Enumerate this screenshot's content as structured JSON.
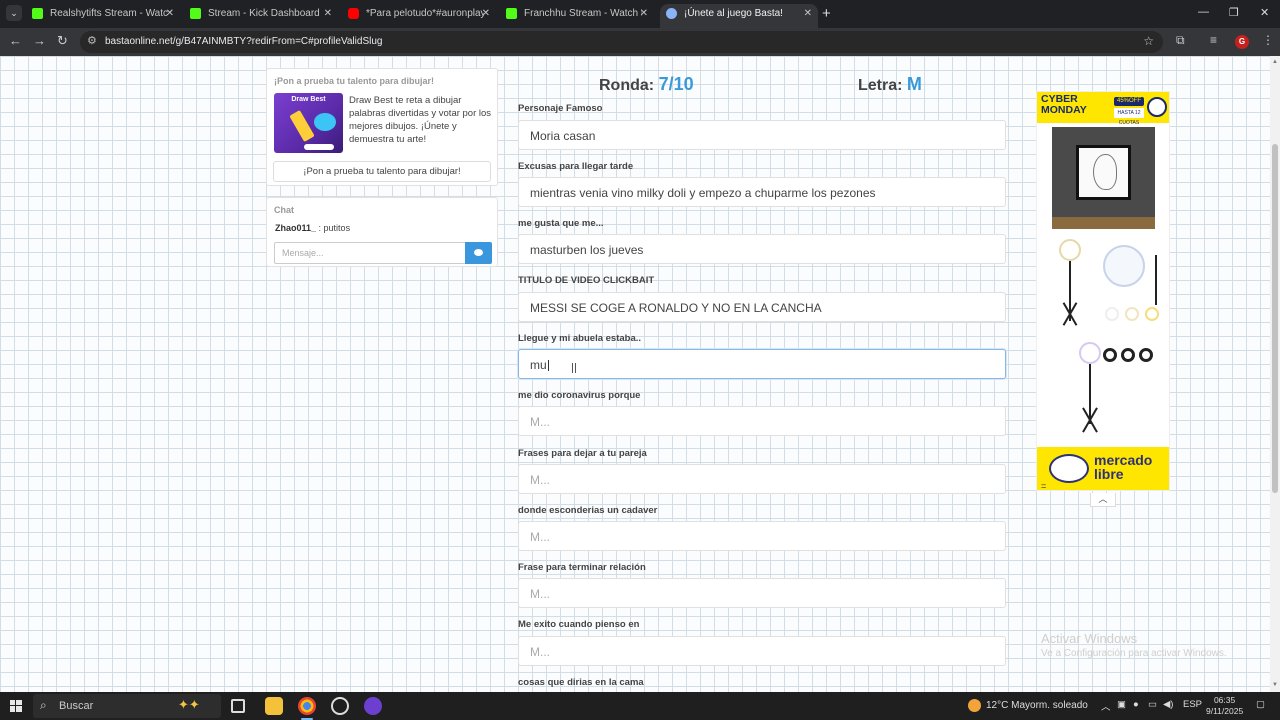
{
  "browser": {
    "tabs": [
      {
        "title": "Realshytifts Stream - Watch Li...",
        "favicon": "kick-icon",
        "close": "✕"
      },
      {
        "title": "Stream - Kick Dashboard",
        "favicon": "kick-icon",
        "close": "✕"
      },
      {
        "title": "*Para pelotudo*#auronplay #tw",
        "favicon": "youtube-icon",
        "close": "✕"
      },
      {
        "title": "Franchhu Stream - Watch Live o",
        "favicon": "kick-icon",
        "close": "✕"
      },
      {
        "title": "¡Únete al juego Basta!",
        "favicon": "globe-icon",
        "close": "✕",
        "active": true
      }
    ],
    "new_tab": "+",
    "url": "bastaonline.net/g/B47AINMBTY?redirFrom=C#profileValidSlug",
    "profile_initial": "G"
  },
  "promo": {
    "heading": "¡Pon a prueba tu talento para dibujar!",
    "thumb_title": "Draw Best",
    "description": "Draw Best te reta a dibujar palabras divertidas y votar por los mejores dibujos. ¡Únete y demuestra tu arte!",
    "cta": "¡Pon a prueba tu talento para dibujar!"
  },
  "chat": {
    "heading": "Chat",
    "messages": [
      {
        "user": "Zhao011_",
        "text": ": putitos"
      }
    ],
    "input_placeholder": "Mensaje..."
  },
  "game": {
    "round_label": "Ronda:",
    "round_value": "7/10",
    "letter_label": "Letra:",
    "letter_value": "M",
    "categories": [
      {
        "label": "Personaje Famoso",
        "value": "Moria casan",
        "placeholder": ""
      },
      {
        "label": "Excusas para llegar tarde",
        "value": "mientras venia vino milky doli y empezo a chuparme los pezones",
        "placeholder": ""
      },
      {
        "label": "me gusta que me...",
        "value": "masturben los jueves",
        "placeholder": ""
      },
      {
        "label": "TITULO DE VIDEO CLICKBAIT",
        "value": "MESSI SE COGE A RONALDO Y NO EN LA CANCHA",
        "placeholder": ""
      },
      {
        "label": "Llegue y mi abuela estaba..",
        "value": "mu",
        "placeholder": "",
        "focused": true
      },
      {
        "label": "me dio coronavirus porque",
        "value": "",
        "placeholder": "M..."
      },
      {
        "label": "Frases para dejar a tu pareja",
        "value": "",
        "placeholder": "M..."
      },
      {
        "label": "donde esconderias un cadaver",
        "value": "",
        "placeholder": "M..."
      },
      {
        "label": "Frase para terminar relación",
        "value": "",
        "placeholder": "M..."
      },
      {
        "label": "Me exito cuando pienso en",
        "value": "",
        "placeholder": "M..."
      },
      {
        "label": "cosas que dirias en la cama",
        "value": "",
        "placeholder": ""
      }
    ]
  },
  "ad": {
    "cyber_line1": "CYBER",
    "cyber_line2": "MONDAY",
    "badge_off": "45%OFF",
    "badge_cuotas": "HASTA 12 CUOTAS",
    "brand_line1": "mercado",
    "brand_line2": "libre",
    "eq_mark": "=",
    "collapse_icon": "︿"
  },
  "watermark": {
    "title": "Activar Windows",
    "subtitle": "Ve a Configuración para activar Windows."
  },
  "taskbar": {
    "search_label": "Buscar",
    "weather": "12°C  Mayorm. soleado",
    "language": "ESP",
    "time": "06:35",
    "date": "9/11/2025"
  }
}
